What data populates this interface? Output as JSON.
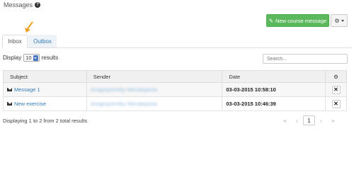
{
  "page": {
    "title": "Messages"
  },
  "toolbar": {
    "new_message_label": "New course message"
  },
  "tabs": [
    {
      "label": "Inbox"
    },
    {
      "label": "Outbox"
    }
  ],
  "display": {
    "prefix": "Display",
    "value": "10",
    "suffix": "results"
  },
  "search": {
    "placeholder": "Search..."
  },
  "table": {
    "columns": [
      "Subject",
      "Sender",
      "Date"
    ],
    "rows": [
      {
        "subject": "Message 1",
        "sender": "Anagrayonniky Wenataykow",
        "date": "03-03-2015 10:58:10"
      },
      {
        "subject": "New exercise",
        "sender": "Anagrayonniky Wenataykow",
        "date": "03-03-2015 10:46:39"
      }
    ]
  },
  "footer": {
    "info": "Displaying 1 to 2 from 2 total results"
  },
  "pagination": {
    "first": "«",
    "prev": "‹",
    "current": "1",
    "next": "›",
    "last": "»"
  },
  "colors": {
    "accent": "#337ab7",
    "success": "#5cb85c",
    "annotation_arrow": "#f0a020"
  }
}
